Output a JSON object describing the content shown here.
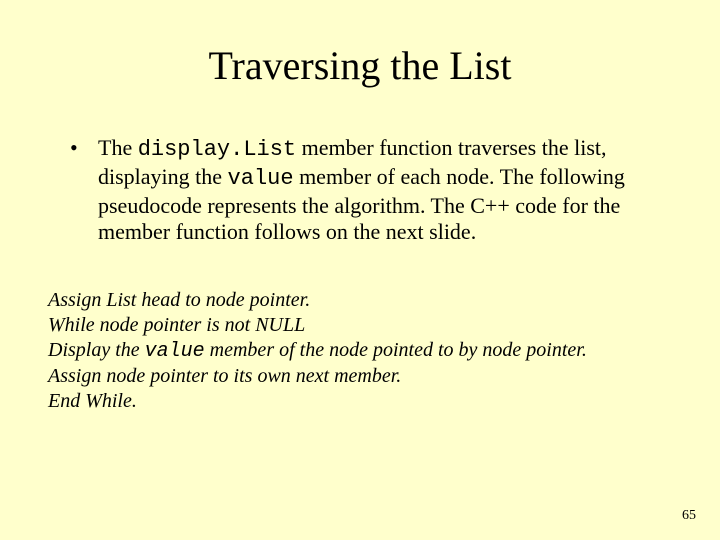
{
  "title": "Traversing the List",
  "bullet": {
    "pre": "The ",
    "code1": "display.List",
    "mid1": " member function traverses the list, displaying the ",
    "code2": "value",
    "post": " member of each node. The following pseudocode represents the algorithm. The C++ code for the member function follows on the next slide."
  },
  "pseudo": {
    "l1": "Assign List head to node pointer.",
    "l2": "While node pointer is not NULL",
    "l3a": "Display the ",
    "l3code": "value",
    "l3b": " member of the node pointed to by node pointer.",
    "l4": "Assign node pointer to its own next member.",
    "l5": "End While."
  },
  "page": "65"
}
